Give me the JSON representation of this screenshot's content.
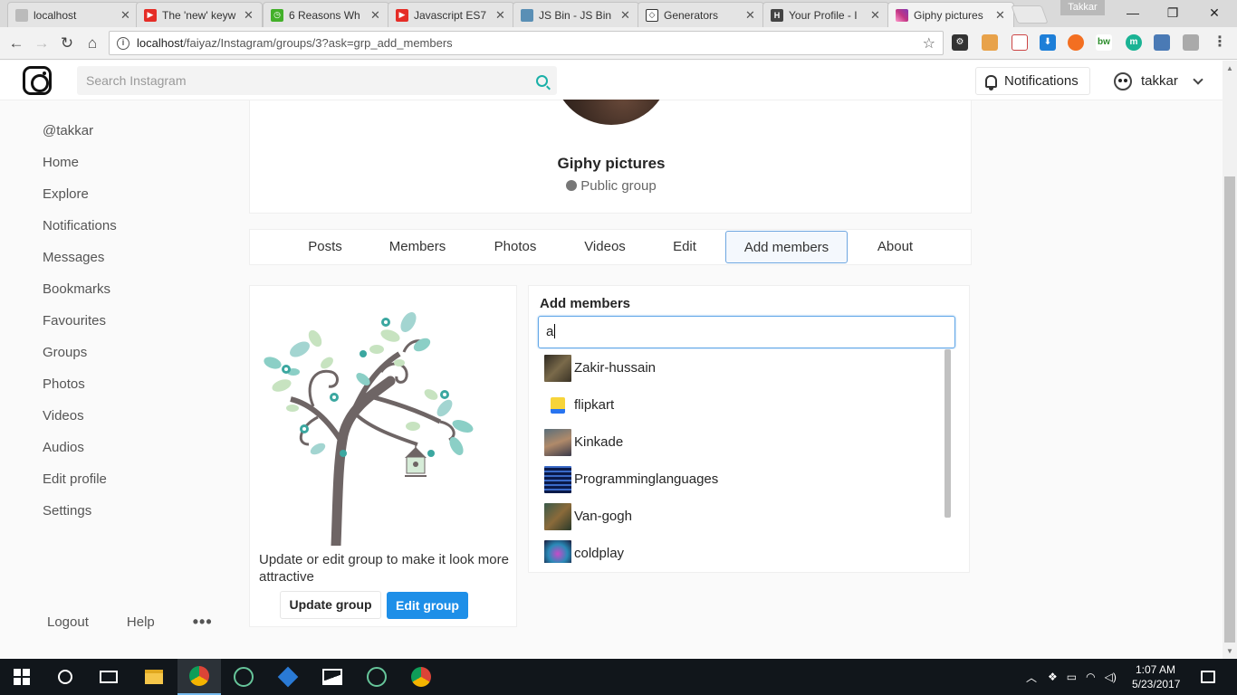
{
  "browser": {
    "tabs": [
      {
        "label": "localhost",
        "favicon": "page-icon",
        "color": "#888888"
      },
      {
        "label": "The 'new' keyw",
        "favicon": "youtube-icon",
        "color": "#e52d27"
      },
      {
        "label": "6 Reasons Wh",
        "favicon": "timer-icon",
        "color": "#43b02a"
      },
      {
        "label": "Javascript ES7",
        "favicon": "youtube-icon",
        "color": "#e52d27"
      },
      {
        "label": "JS Bin - JS Bin",
        "favicon": "jsbin-icon",
        "color": "#5a8fb5"
      },
      {
        "label": "Generators",
        "favicon": "codepen-icon",
        "color": "#333333"
      },
      {
        "label": "Your Profile - I",
        "favicon": "h-icon",
        "color": "#444444"
      },
      {
        "label": "Giphy pictures",
        "favicon": "instagram-icon",
        "color": "#c13584"
      }
    ],
    "profile_name": "Takkar",
    "url_host": "localhost",
    "url_path": "/faiyaz/Instagram/groups/3?ask=grp_add_members"
  },
  "header": {
    "search_placeholder": "Search Instagram",
    "notifications_label": "Notifications",
    "username": "takkar"
  },
  "sidebar": {
    "items": [
      {
        "label": "@takkar"
      },
      {
        "label": "Home"
      },
      {
        "label": "Explore"
      },
      {
        "label": "Notifications"
      },
      {
        "label": "Messages"
      },
      {
        "label": "Bookmarks"
      },
      {
        "label": "Favourites"
      },
      {
        "label": "Groups"
      },
      {
        "label": "Photos"
      },
      {
        "label": "Videos"
      },
      {
        "label": "Audios"
      },
      {
        "label": "Edit profile"
      },
      {
        "label": "Settings"
      }
    ],
    "footer": {
      "logout": "Logout",
      "help": "Help",
      "more": "•••"
    }
  },
  "group": {
    "name": "Giphy pictures",
    "type": "Public group",
    "tabs": [
      {
        "label": "Posts"
      },
      {
        "label": "Members"
      },
      {
        "label": "Photos"
      },
      {
        "label": "Videos"
      },
      {
        "label": "Edit"
      },
      {
        "label": "Add members",
        "active": true
      },
      {
        "label": "About"
      }
    ]
  },
  "update_card": {
    "text": "Update or edit group to make it look more attractive",
    "update_button": "Update group",
    "edit_button": "Edit group"
  },
  "add_members": {
    "title": "Add members",
    "input_value": "a",
    "suggestions": [
      {
        "name": "Zakir-hussain",
        "thumb_color": "#4a3b2a"
      },
      {
        "name": "flipkart",
        "thumb_color": "#f7d43a"
      },
      {
        "name": "Kinkade",
        "thumb_color": "#6b5a48"
      },
      {
        "name": "Programminglanguages",
        "thumb_color": "#1a3a7a"
      },
      {
        "name": "Van-gogh",
        "thumb_color": "#5a6a3a"
      },
      {
        "name": "coldplay",
        "thumb_color": "#6a2a7a"
      }
    ]
  },
  "taskbar": {
    "time": "1:07 AM",
    "date": "5/23/2017"
  }
}
